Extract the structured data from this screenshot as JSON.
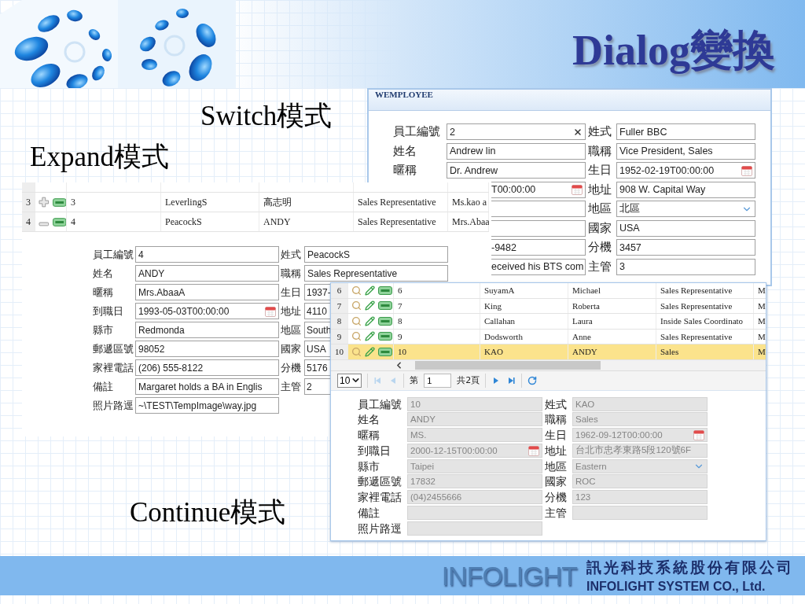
{
  "title": "Dialog變換",
  "captions": [
    {
      "kind": "switch",
      "text": "Switch模式"
    },
    {
      "kind": "expand",
      "text": "Expand模式"
    },
    {
      "kind": "continue",
      "text": "Continue模式"
    }
  ],
  "switch_panel": {
    "title": "WEMPLOYEE",
    "rows": [
      {
        "left": {
          "label": "員工編號",
          "value": "2",
          "kind": "clear"
        },
        "right": {
          "label": "姓式",
          "value": "Fuller BBC"
        }
      },
      {
        "left": {
          "label": "姓名",
          "value": "Andrew lin"
        },
        "right": {
          "label": "職稱",
          "value": "Vice President, Sales"
        }
      },
      {
        "left": {
          "label": "暱稱",
          "value": "Dr. Andrew"
        },
        "right": {
          "label": "生日",
          "value": "1952-02-19T00:00:00",
          "kind": "date"
        }
      },
      {
        "left": {
          "value": "T00:00:00",
          "kind": "date"
        },
        "right": {
          "label": "地址",
          "value": "908 W. Capital Way"
        }
      },
      {
        "left": {},
        "right": {
          "label": "地區",
          "value": "北區",
          "kind": "select"
        }
      },
      {
        "left": {},
        "right": {
          "label": "國家",
          "value": "USA"
        }
      },
      {
        "left": {
          "value": "-9482"
        },
        "right": {
          "label": "分機",
          "value": "3457"
        }
      },
      {
        "left": {
          "value": "eceived his BTS com"
        },
        "right": {
          "label": "主管",
          "value": "3"
        }
      }
    ]
  },
  "expand_panel": {
    "grid": {
      "rows": [
        {
          "number": "3",
          "expanded": false,
          "cells": [
            "3",
            "LeverlingS",
            "高志明",
            "Sales Representative",
            "Ms.kao a"
          ]
        },
        {
          "number": "4",
          "expanded": true,
          "cells": [
            "4",
            "PeacockS",
            "ANDY",
            "Sales Representative",
            "Mrs.Abaa"
          ]
        }
      ]
    },
    "form": {
      "rows": [
        {
          "left": {
            "label": "員工編號",
            "value": "4"
          },
          "right": {
            "label": "姓式",
            "value": "PeacockS"
          }
        },
        {
          "left": {
            "label": "姓名",
            "value": "ANDY"
          },
          "right": {
            "label": "職稱",
            "value": "Sales Representative"
          }
        },
        {
          "left": {
            "label": "暱稱",
            "value": "Mrs.AbaaA"
          },
          "right": {
            "label": "生日",
            "value": "1937-"
          }
        },
        {
          "left": {
            "label": "到職日",
            "value": "1993-05-03T00:00:00",
            "kind": "date"
          },
          "right": {
            "label": "地址",
            "value": "4110"
          }
        },
        {
          "left": {
            "label": "縣市",
            "value": "Redmonda"
          },
          "right": {
            "label": "地區",
            "value": "South"
          }
        },
        {
          "left": {
            "label": "郵遞區號",
            "value": "98052"
          },
          "right": {
            "label": "國家",
            "value": "USA"
          }
        },
        {
          "left": {
            "label": "家裡電話",
            "value": "(206) 555-8122"
          },
          "right": {
            "label": "分機",
            "value": "5176"
          }
        },
        {
          "left": {
            "label": "備註",
            "value": "Margaret holds a BA in Englis"
          },
          "right": {
            "label": "主管",
            "value": "2"
          }
        },
        {
          "left": {
            "label": "照片路逕",
            "value": "~\\TEST\\TempImage\\way.jpg"
          }
        }
      ]
    }
  },
  "continue_panel": {
    "grid": {
      "rows": [
        {
          "number": "6",
          "selected": false,
          "cells": [
            "6",
            "SuyamA",
            "Michael",
            "Sales Representative",
            "M"
          ]
        },
        {
          "number": "7",
          "selected": false,
          "cells": [
            "7",
            "King",
            "Roberta",
            "Sales Representative",
            "M"
          ]
        },
        {
          "number": "8",
          "selected": false,
          "cells": [
            "8",
            "Callahan",
            "Laura",
            "Inside Sales Coordinato",
            "M"
          ]
        },
        {
          "number": "9",
          "selected": false,
          "cells": [
            "9",
            "Dodsworth",
            "Anne",
            "Sales Representative",
            "M"
          ]
        },
        {
          "number": "10",
          "selected": true,
          "cells": [
            "10",
            "KAO",
            "ANDY",
            "Sales",
            "M"
          ]
        }
      ]
    },
    "pager": {
      "page_size": "10",
      "page_prefix": "第",
      "page": "1",
      "page_total": "共2頁",
      "can_go_back": false
    },
    "form": {
      "disabled": true,
      "rows": [
        {
          "left": {
            "label": "員工編號",
            "value": "10"
          },
          "right": {
            "label": "姓式",
            "value": "KAO"
          }
        },
        {
          "left": {
            "label": "姓名",
            "value": "ANDY"
          },
          "right": {
            "label": "職稱",
            "value": "Sales"
          }
        },
        {
          "left": {
            "label": "暱稱",
            "value": "MS."
          },
          "right": {
            "label": "生日",
            "value": "1962-09-12T00:00:00",
            "kind": "date"
          }
        },
        {
          "left": {
            "label": "到職日",
            "value": "2000-12-15T00:00:00",
            "kind": "date"
          },
          "right": {
            "label": "地址",
            "value": "台北市忠孝東路5段120號6F"
          }
        },
        {
          "left": {
            "label": "縣市",
            "value": "Taipei"
          },
          "right": {
            "label": "地區",
            "value": "Eastern",
            "kind": "select"
          }
        },
        {
          "left": {
            "label": "郵遞區號",
            "value": "17832"
          },
          "right": {
            "label": "國家",
            "value": "ROC"
          }
        },
        {
          "left": {
            "label": "家裡電話",
            "value": "(04)2455666"
          },
          "right": {
            "label": "分機",
            "value": "123"
          }
        },
        {
          "left": {
            "label": "備註"
          },
          "right": {
            "label": "主管"
          }
        },
        {
          "left": {
            "label": "照片路逕"
          }
        }
      ]
    }
  },
  "footer": {
    "logo": "INFOLIGHT",
    "company_name": "訊光科技系統股份有限公司",
    "company_name_en": "INFOLIGHT SYSTEM CO., Ltd."
  }
}
